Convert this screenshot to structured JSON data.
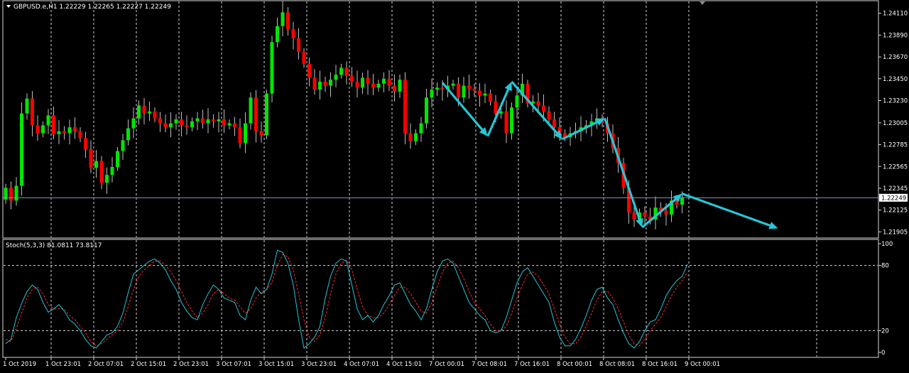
{
  "header": {
    "symbol_line": "GBPUSD.e,H1  1.22229 1.22265 1.22227 1.22249"
  },
  "stoch_header": "Stoch(5,3,3) 81.0811 73.8117",
  "colors": {
    "background": "#000000",
    "bull": "#00e600",
    "bear": "#ff0000",
    "wick": "#bfbfbf",
    "frame": "#d9d9d9",
    "grid": "#d9d9d9",
    "arrow": "#26c6d6",
    "stoch_main": "#26c6d6",
    "stoch_signal": "#ff2a2a",
    "price_line": "#8a96b8"
  },
  "chart_data": [
    {
      "type": "candlestick",
      "symbol": "GBPUSD.e",
      "timeframe": "H1",
      "ohlc_header": {
        "open": 1.22229,
        "high": 1.22265,
        "low": 1.22227,
        "close": 1.22249
      },
      "current_price": 1.22249,
      "current_price_label": "1.22249",
      "ylim": [
        1.2185,
        1.2423
      ],
      "y_ticks": [
        "1.24110",
        "1.23890",
        "1.23670",
        "1.23450",
        "1.23230",
        "1.23005",
        "1.22785",
        "1.22565",
        "1.22345",
        "1.22125",
        "1.21905"
      ],
      "x_labels": [
        "1 Oct 2019",
        "1 Oct 23:01",
        "2 Oct 07:01",
        "2 Oct 15:01",
        "2 Oct 23:01",
        "3 Oct 07:01",
        "3 Oct 15:01",
        "3 Oct 23:01",
        "4 Oct 07:01",
        "4 Oct 15:01",
        "7 Oct 00:01",
        "7 Oct 08:01",
        "7 Oct 16:01",
        "8 Oct 00:01",
        "8 Oct 08:01",
        "8 Oct 16:01",
        "9 Oct 00:01"
      ],
      "grid": true,
      "arrow_path_prices": [
        [
          0,
          1.2341
        ],
        [
          8.5,
          1.2287
        ],
        [
          13,
          1.2342
        ],
        [
          22.5,
          1.2284
        ],
        [
          30.5,
          1.2305
        ],
        [
          37.5,
          1.2195
        ],
        [
          45,
          1.2229
        ],
        [
          63,
          1.2194
        ]
      ],
      "closes": [
        1.2235,
        1.2222,
        1.2237,
        1.231,
        1.2325,
        1.2298,
        1.229,
        1.2298,
        1.2308,
        1.2289,
        1.2292,
        1.229,
        1.2296,
        1.2292,
        1.2285,
        1.2274,
        1.2255,
        1.2262,
        1.224,
        1.2248,
        1.2256,
        1.2272,
        1.2283,
        1.2295,
        1.2305,
        1.2318,
        1.231,
        1.2312,
        1.2305,
        1.23,
        1.2296,
        1.23,
        1.2304,
        1.2298,
        1.2296,
        1.2302,
        1.2305,
        1.23,
        1.2304,
        1.2302,
        1.2304,
        1.2298,
        1.23,
        1.2296,
        1.228,
        1.23,
        1.2326,
        1.2292,
        1.2288,
        1.233,
        1.2382,
        1.2398,
        1.2412,
        1.2395,
        1.2386,
        1.2372,
        1.236,
        1.2346,
        1.2334,
        1.2342,
        1.2338,
        1.2344,
        1.2349,
        1.2356,
        1.2348,
        1.2342,
        1.2336,
        1.2346,
        1.234,
        1.2336,
        1.234,
        1.2345,
        1.2338,
        1.2332,
        1.2344,
        1.229,
        1.2282,
        1.229,
        1.23,
        1.2326,
        1.2334,
        1.2336,
        1.2334,
        1.2338,
        1.234,
        1.2326,
        1.2338,
        1.2335,
        1.2333,
        1.2328,
        1.233,
        1.2322,
        1.231,
        1.2312,
        1.229,
        1.2316,
        1.2328,
        1.234,
        1.232,
        1.2322,
        1.2318,
        1.2312,
        1.2304,
        1.2296,
        1.229,
        1.2286,
        1.229,
        1.2292,
        1.2296,
        1.2298,
        1.2302,
        1.2305,
        1.23,
        1.229,
        1.2275,
        1.226,
        1.2235,
        1.221,
        1.2203,
        1.221,
        1.2206,
        1.2203,
        1.2215,
        1.2212,
        1.2208,
        1.2222,
        1.2218,
        1.2225
      ]
    },
    {
      "type": "line",
      "title": "Stoch(5,3,3) 81.0811 73.8117",
      "ylim": [
        0,
        100
      ],
      "y_ticks": [
        100,
        80,
        20,
        0
      ],
      "levels": [
        80,
        20
      ],
      "series": [
        {
          "name": "Stoch(5,3,3) 81.0811",
          "values": [
            8,
            12,
            32,
            45,
            56,
            62,
            58,
            46,
            37,
            40,
            44,
            38,
            30,
            26,
            20,
            12,
            6,
            4,
            10,
            16,
            18,
            24,
            36,
            55,
            72,
            76,
            80,
            84,
            86,
            82,
            76,
            66,
            58,
            46,
            38,
            32,
            30,
            44,
            54,
            62,
            58,
            50,
            48,
            46,
            34,
            30,
            48,
            60,
            54,
            58,
            72,
            94,
            92,
            82,
            62,
            30,
            4,
            8,
            14,
            24,
            50,
            70,
            82,
            86,
            84,
            62,
            40,
            30,
            34,
            28,
            34,
            44,
            52,
            62,
            64,
            54,
            44,
            38,
            30,
            40,
            58,
            74,
            84,
            86,
            82,
            70,
            58,
            46,
            40,
            34,
            30,
            20,
            18,
            20,
            32,
            48,
            64,
            74,
            78,
            70,
            62,
            54,
            46,
            28,
            14,
            6,
            6,
            12,
            22,
            34,
            48,
            58,
            60,
            50,
            44,
            30,
            18,
            8,
            4,
            10,
            20,
            28,
            30,
            40,
            52,
            60,
            66,
            70,
            81
          ]
        },
        {
          "name": "73.8117",
          "values": [
            12,
            10,
            22,
            36,
            50,
            58,
            60,
            54,
            44,
            40,
            40,
            40,
            34,
            30,
            24,
            18,
            10,
            6,
            8,
            12,
            16,
            20,
            28,
            42,
            58,
            70,
            76,
            80,
            84,
            84,
            80,
            74,
            66,
            56,
            46,
            38,
            32,
            36,
            44,
            54,
            58,
            54,
            50,
            48,
            42,
            36,
            40,
            50,
            56,
            58,
            64,
            80,
            90,
            88,
            76,
            54,
            30,
            14,
            10,
            16,
            32,
            54,
            72,
            82,
            85,
            76,
            58,
            42,
            34,
            32,
            32,
            36,
            44,
            52,
            60,
            60,
            54,
            46,
            38,
            36,
            46,
            60,
            74,
            82,
            84,
            78,
            68,
            56,
            46,
            40,
            34,
            26,
            20,
            20,
            24,
            36,
            50,
            62,
            72,
            74,
            70,
            62,
            54,
            40,
            26,
            14,
            8,
            8,
            14,
            24,
            36,
            48,
            56,
            56,
            50,
            40,
            28,
            16,
            8,
            6,
            12,
            20,
            26,
            32,
            42,
            52,
            60,
            66,
            74
          ]
        }
      ]
    }
  ]
}
